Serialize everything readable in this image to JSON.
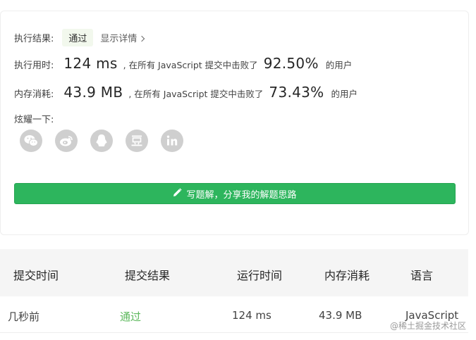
{
  "result": {
    "label": "执行结果:",
    "status": "通过",
    "details_link": "显示详情"
  },
  "runtime": {
    "label": "执行用时:",
    "value": "124 ms",
    "text_before": ", 在所有 JavaScript 提交中击败了",
    "percent": "92.50%",
    "text_after": "的用户"
  },
  "memory": {
    "label": "内存消耗:",
    "value": "43.9 MB",
    "text_before": ", 在所有 JavaScript 提交中击败了",
    "percent": "73.43%",
    "text_after": "的用户"
  },
  "share": {
    "label": "炫耀一下:",
    "icons": [
      "wechat-icon",
      "weibo-icon",
      "qq-icon",
      "douban-icon",
      "linkedin-icon"
    ],
    "icon_color": "#cfcfcf"
  },
  "solution_button": {
    "label": "写题解，分享我的解题思路",
    "color": "#2db55d"
  },
  "submissions": {
    "headers": [
      "提交时间",
      "提交结果",
      "运行时间",
      "内存消耗",
      "语言"
    ],
    "rows": [
      {
        "time": "几秒前",
        "result": "通过",
        "runtime": "124 ms",
        "memory": "43.9 MB",
        "language": "JavaScript"
      }
    ],
    "pass_color": "#5cb85c"
  },
  "watermark": "@稀土掘金技术社区"
}
